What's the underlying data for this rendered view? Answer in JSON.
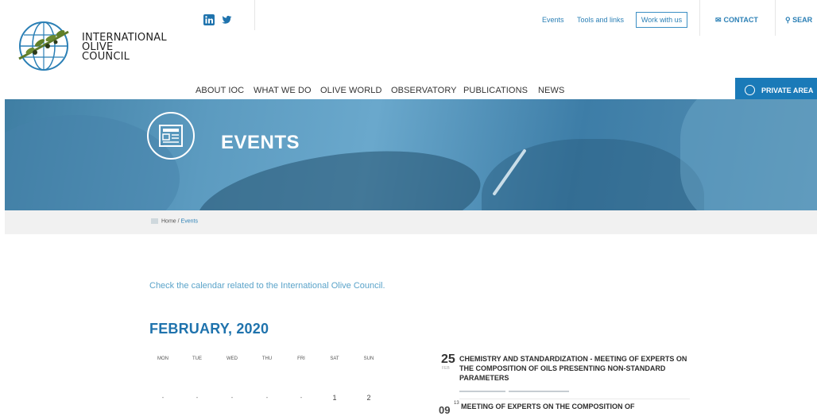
{
  "header": {
    "logo_lines": [
      "INTERNATIONAL",
      "OLIVE",
      "COUNCIL"
    ],
    "social": [
      "linkedin-icon",
      "twitter-icon"
    ],
    "top_links": {
      "events": "Events",
      "tools": "Tools and links",
      "work": "Work with us",
      "contact": "CONTACT",
      "search": "SEAR"
    },
    "nav": [
      "ABOUT IOC",
      "WHAT WE DO",
      "OLIVE WORLD",
      "OBSERVATORY",
      "PUBLICATIONS",
      "NEWS"
    ],
    "private_area": "PRIVATE AREA"
  },
  "hero": {
    "title": "EVENTS",
    "icon": "newspaper-icon"
  },
  "breadcrumb": {
    "home": "Home",
    "separator": "/",
    "current": "Events"
  },
  "main": {
    "intro": "Check the calendar related to the International Olive Council.",
    "month": "FEBRUARY, 2020",
    "weekdays": [
      "MON",
      "TUE",
      "WED",
      "THU",
      "FRI",
      "SAT",
      "SUN"
    ],
    "first_week": [
      "-",
      "-",
      "-",
      "-",
      "-",
      "1",
      "2"
    ]
  },
  "events": [
    {
      "day": "25",
      "month": "FEB",
      "title": "CHEMISTRY AND STANDARDIZATION - MEETING OF EXPERTS ON THE COMPOSITION OF OILS PRESENTING NON-STANDARD PARAMETERS"
    },
    {
      "day": "09",
      "sup": "13",
      "title": "MEETING OF EXPERTS ON THE COMPOSITION OF"
    }
  ],
  "colors": {
    "brand_blue": "#1a7ab8",
    "link_blue": "#2a7fb5",
    "hero_blue": "#5c9bc0"
  }
}
